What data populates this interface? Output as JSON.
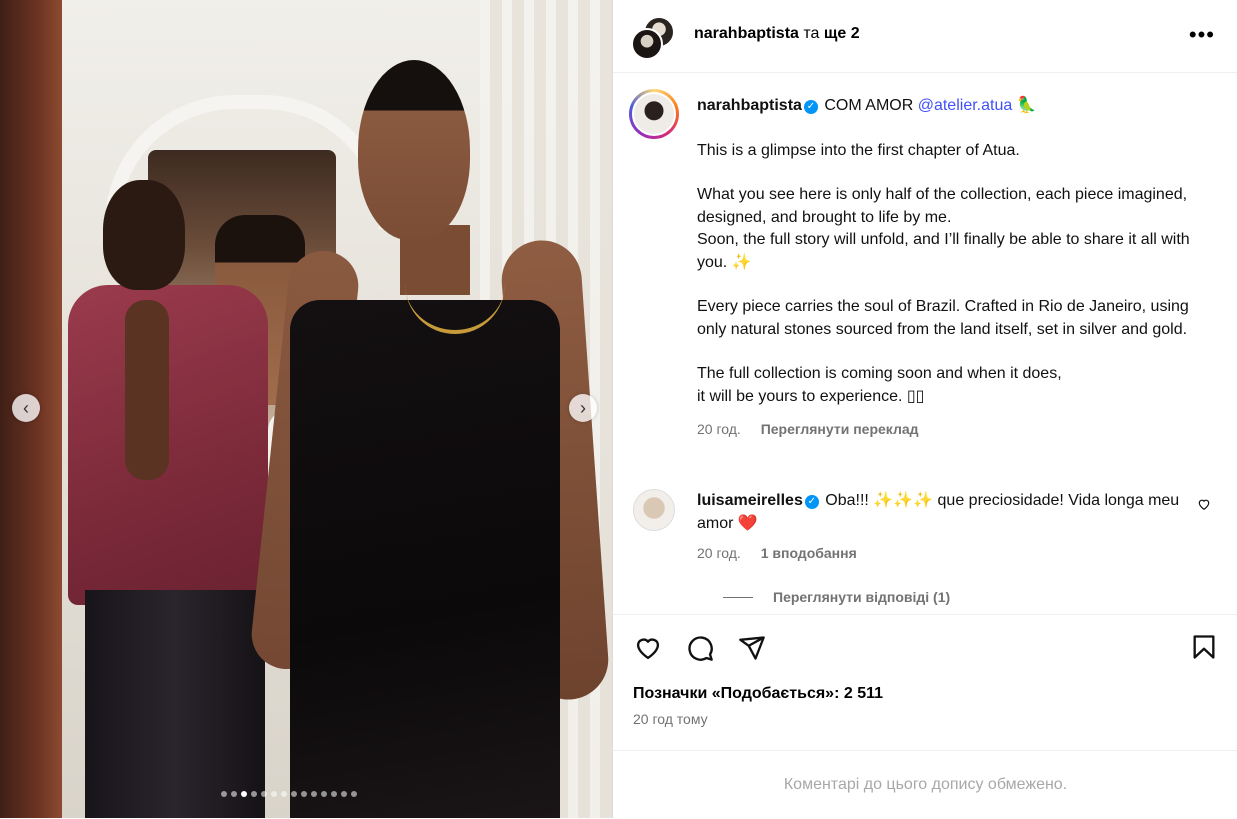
{
  "header": {
    "username": "narahbaptista",
    "and_text": "та",
    "others": "ще 2",
    "more_icon": "more-horizontal-icon"
  },
  "caption": {
    "username": "narahbaptista",
    "title": "COM AMOR",
    "mention": "@atelier.atua",
    "title_emoji": "🦜",
    "paragraphs": [
      "This is a glimpse into the first chapter of Atua.",
      "What you see here is only half of the collection, each piece imagined, designed, and brought to life by me.",
      "Soon, the full story will unfold, and I’ll finally be able to share it all with you. ✨",
      "Every piece carries the soul of Brazil. Crafted in Rio de Janeiro, using only natural stones sourced from the land itself, set in silver and gold.",
      "The full collection is coming soon and when it does,",
      "it will be yours to experience. ▯▯"
    ],
    "time": "20 год.",
    "translate": "Переглянути переклад"
  },
  "comment": {
    "username": "luisameirelles",
    "text": "Oba!!! ✨✨✨ que preciosidade! Vida longa meu amor ❤️",
    "time": "20 год.",
    "likes": "1 вподобання",
    "view_replies": "Переглянути відповіді (1)"
  },
  "actions": {
    "likes_label": "Позначки «Подобається»: 2 511",
    "posted": "20 год тому"
  },
  "footer": {
    "comments_limited": "Коментарі до цього допису обмежено."
  },
  "carousel": {
    "slide_count": 14,
    "active_index": 2,
    "prev_icon": "chevron-left-icon",
    "next_icon": "chevron-right-icon"
  },
  "colors": {
    "verified": "#0095f6",
    "mention": "#4150f7",
    "muted": "#737373"
  }
}
